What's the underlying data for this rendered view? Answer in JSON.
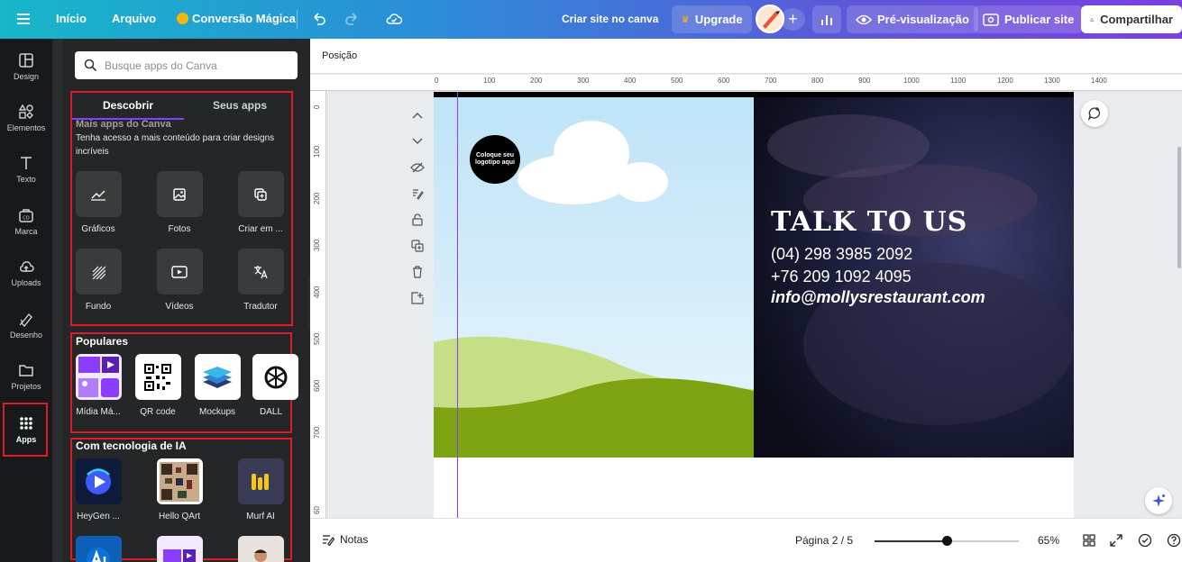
{
  "topbar": {
    "inicio": "Início",
    "arquivo": "Arquivo",
    "magic": "Conversão Mágica",
    "criar_site": "Criar site no canva",
    "upgrade": "Upgrade",
    "preview": "Pré-visualização",
    "publicar": "Publicar site",
    "compartilhar": "Compartilhar"
  },
  "rail": {
    "items": [
      {
        "label": "Design"
      },
      {
        "label": "Elementos"
      },
      {
        "label": "Texto"
      },
      {
        "label": "Marca"
      },
      {
        "label": "Uploads"
      },
      {
        "label": "Desenho"
      },
      {
        "label": "Projetos"
      },
      {
        "label": "Apps"
      }
    ]
  },
  "panel": {
    "search_placeholder": "Busque apps do Canva",
    "tabs": [
      "Descobrir",
      "Seus apps"
    ],
    "more_apps": {
      "title": "Mais apps do Canva",
      "desc": "Tenha acesso a mais conteúdo para criar designs incríveis",
      "apps": [
        "Gráficos",
        "Fotos",
        "Criar em ...",
        "Fundo",
        "Vídeos",
        "Tradutor"
      ]
    },
    "popular": {
      "title": "Populares",
      "apps": [
        "Mídia Má...",
        "QR code",
        "Mockups",
        "DALL"
      ]
    },
    "ai": {
      "title": "Com tecnologia de IA",
      "apps": [
        "HeyGen ...",
        "Hello QArt",
        "Murf AI"
      ]
    }
  },
  "canvas": {
    "props_label": "Posição",
    "ruler_top": [
      "0",
      "100",
      "200",
      "300",
      "400",
      "500",
      "600",
      "700",
      "800",
      "900",
      "1000",
      "1100",
      "1200",
      "1300",
      "1400"
    ],
    "ruler_left": [
      "0",
      "100",
      "200",
      "300",
      "400",
      "500",
      "600",
      "700",
      "60"
    ],
    "design": {
      "logo_text": "Coloque seu logotipo aqui",
      "heading": "TALK TO US",
      "phone1": "(04) 298 3985 2092",
      "phone2": "+76 209 1092 4095",
      "email": "info@mollysrestaurant.com"
    }
  },
  "bottom": {
    "notes": "Notas",
    "page": "Página 2 / 5",
    "zoom": "65%",
    "zoom_level": 0.5
  },
  "colors": {
    "accent": "#8b3dff",
    "highlight": "#e01b24",
    "panel_bg": "#252627",
    "rail_bg": "#18191b"
  }
}
